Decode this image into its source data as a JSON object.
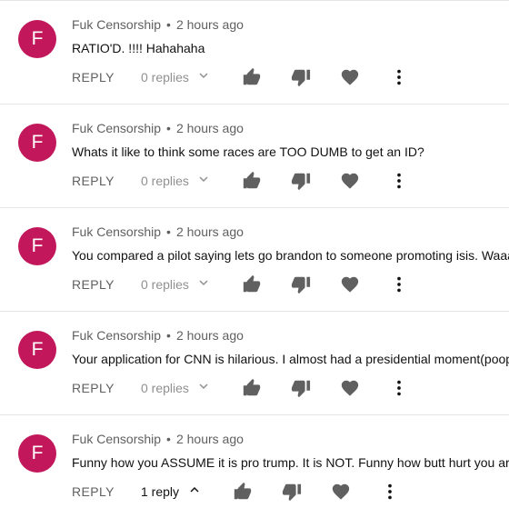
{
  "comments": [
    {
      "avatar_letter": "F",
      "author": "Fuk Censorship",
      "dot": "•",
      "time": "2 hours ago",
      "text": "RATIO'D. !!!! Hahahaha",
      "reply_label": "REPLY",
      "replies_label": "0 replies",
      "expanded": false
    },
    {
      "avatar_letter": "F",
      "author": "Fuk Censorship",
      "dot": "•",
      "time": "2 hours ago",
      "text": "Whats it like to think some races are TOO DUMB to get an ID?",
      "reply_label": "REPLY",
      "replies_label": "0 replies",
      "expanded": false
    },
    {
      "avatar_letter": "F",
      "author": "Fuk Censorship",
      "dot": "•",
      "time": "2 hours ago",
      "text": "You compared a pilot saying lets go brandon to someone promoting isis.  Waaay",
      "reply_label": "REPLY",
      "replies_label": "0 replies",
      "expanded": false
    },
    {
      "avatar_letter": "F",
      "author": "Fuk Censorship",
      "dot": "•",
      "time": "2 hours ago",
      "text": "Your application for CNN is hilarious. I almost had a presidential moment(poope",
      "reply_label": "REPLY",
      "replies_label": "0 replies",
      "expanded": false
    },
    {
      "avatar_letter": "F",
      "author": "Fuk Censorship",
      "dot": "•",
      "time": "2 hours ago",
      "text": "Funny how you ASSUME it is pro trump. It is NOT. Funny how butt hurt you are 🤡",
      "reply_label": "REPLY",
      "replies_label": "1 reply",
      "expanded": true
    }
  ],
  "icons": {
    "like": "thumbs-up-icon",
    "dislike": "thumbs-down-icon",
    "heart": "heart-icon",
    "more": "more-vert-icon",
    "chevron_down": "chevron-down-icon",
    "chevron_up": "chevron-up-icon"
  },
  "colors": {
    "avatar": "#c2185b",
    "icon": "#606060",
    "divider": "#e5e5e5"
  }
}
